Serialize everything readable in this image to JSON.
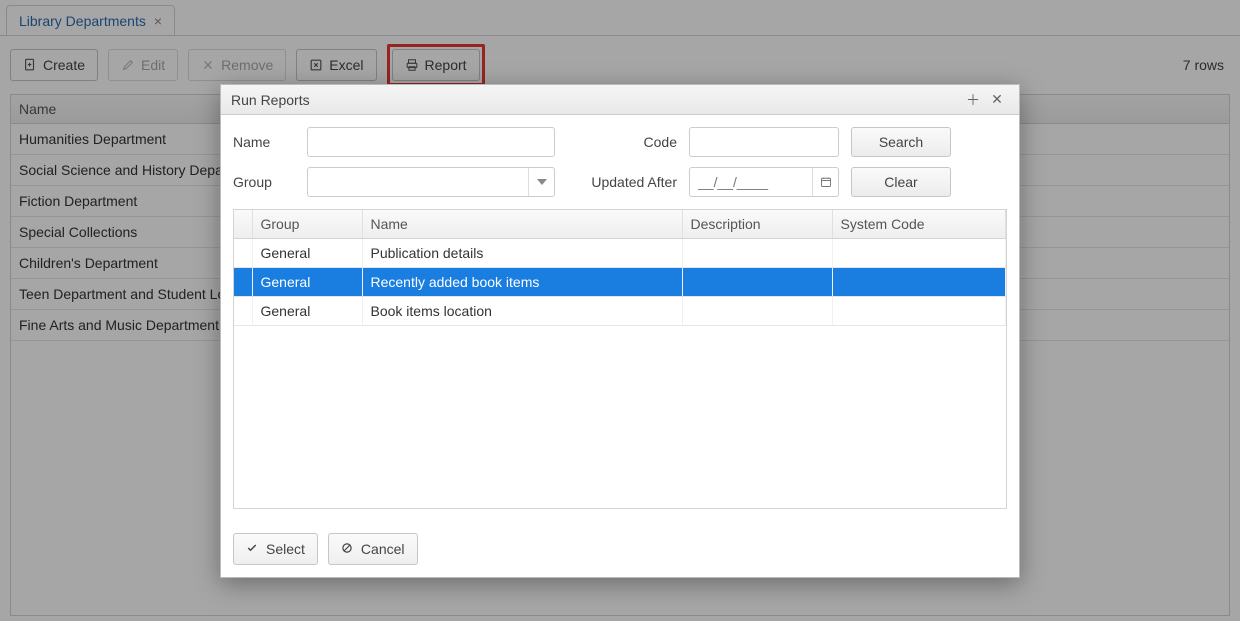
{
  "tab": {
    "title": "Library Departments"
  },
  "toolbar": {
    "create": "Create",
    "edit": "Edit",
    "remove": "Remove",
    "excel": "Excel",
    "report": "Report"
  },
  "rowcount": "7 rows",
  "grid": {
    "header": "Name",
    "rows": [
      "Humanities Department",
      "Social Science and History Department",
      "Fiction Department",
      "Special Collections",
      "Children's Department",
      "Teen Department and Student Lounge",
      "Fine Arts and Music Department"
    ]
  },
  "dialog": {
    "title": "Run Reports",
    "filters": {
      "name_label": "Name",
      "code_label": "Code",
      "group_label": "Group",
      "updated_label": "Updated After",
      "date_placeholder": "__/__/____",
      "search": "Search",
      "clear": "Clear"
    },
    "columns": {
      "group": "Group",
      "name": "Name",
      "desc": "Description",
      "code": "System Code"
    },
    "rows": [
      {
        "group": "General",
        "name": "Publication details",
        "desc": "",
        "code": "",
        "selected": false
      },
      {
        "group": "General",
        "name": "Recently added book items",
        "desc": "",
        "code": "",
        "selected": true
      },
      {
        "group": "General",
        "name": "Book items location",
        "desc": "",
        "code": "",
        "selected": false
      }
    ],
    "footer": {
      "select": "Select",
      "cancel": "Cancel"
    }
  }
}
